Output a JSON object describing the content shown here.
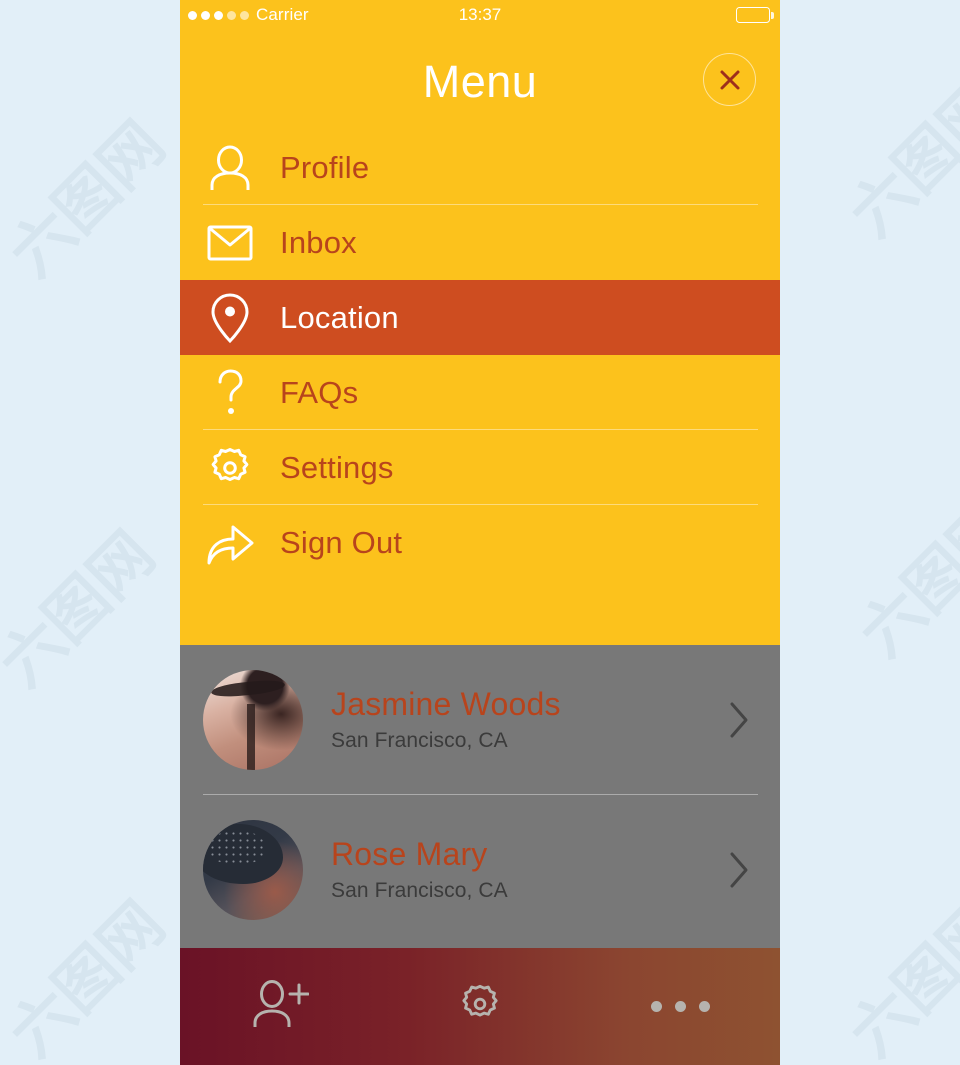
{
  "colors": {
    "page_background": "#E2EFF8",
    "menu_background": "#FCC21C",
    "active_row": "#CE4D20",
    "menu_label": "#B8441C",
    "contacts_background": "#787878",
    "toolbar_gradient_start": "#6A1226",
    "toolbar_gradient_end": "#8E5231",
    "white": "#FFFFFF"
  },
  "status_bar": {
    "carrier": "Carrier",
    "time": "13:37",
    "signal_dots": 5,
    "signal_filled": 3,
    "battery_icon": "battery-icon",
    "battery_level_percent": 78
  },
  "header": {
    "title": "Menu",
    "close_icon": "close-icon"
  },
  "menu": {
    "items": [
      {
        "label": "Profile",
        "icon": "user-icon",
        "active": false,
        "divider": true
      },
      {
        "label": "Inbox",
        "icon": "envelope-icon",
        "active": false,
        "divider": false
      },
      {
        "label": "Location",
        "icon": "map-pin-icon",
        "active": true,
        "divider": false
      },
      {
        "label": "FAQs",
        "icon": "question-icon",
        "active": false,
        "divider": true
      },
      {
        "label": "Settings",
        "icon": "gear-icon",
        "active": false,
        "divider": true
      },
      {
        "label": "Sign Out",
        "icon": "share-arrow-icon",
        "active": false,
        "divider": false
      }
    ]
  },
  "contacts": [
    {
      "name": "Jasmine Woods",
      "location": "San Francisco, CA",
      "avatar": "avatar-jasmine-woods",
      "chevron_icon": "chevron-right-icon",
      "divider": true
    },
    {
      "name": "Rose Mary",
      "location": "San Francisco, CA",
      "avatar": "avatar-rose-mary",
      "chevron_icon": "chevron-right-icon",
      "divider": false
    }
  ],
  "toolbar": {
    "items": [
      {
        "icon": "add-user-icon"
      },
      {
        "icon": "gear-icon"
      },
      {
        "icon": "more-dots-icon"
      }
    ]
  },
  "watermarks": [
    "六图网",
    "六图网",
    "六图网",
    "六图网",
    "六图网",
    "六图网"
  ]
}
